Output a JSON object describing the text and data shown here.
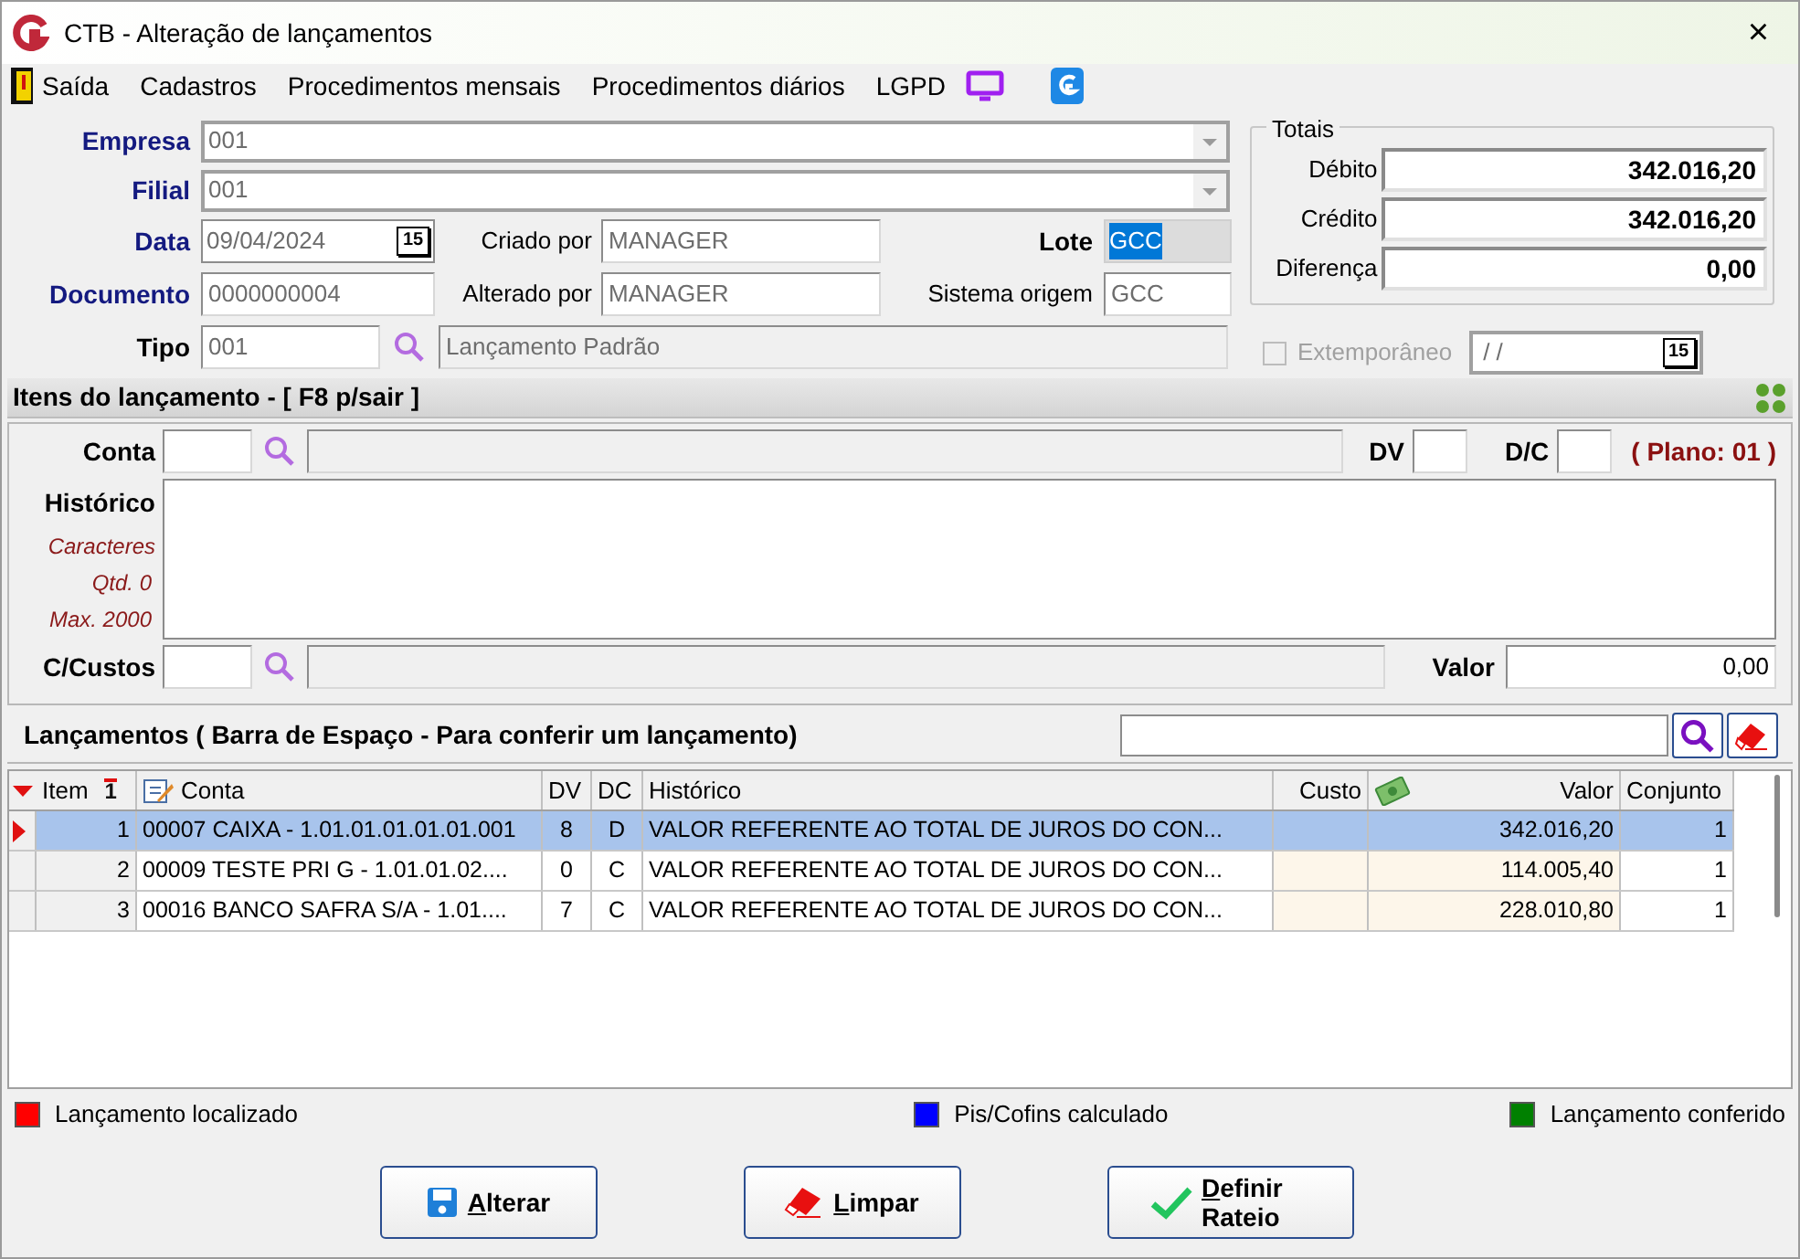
{
  "window": {
    "title": "CTB - Alteração de lançamentos",
    "close": "×"
  },
  "menu": [
    {
      "label": "Saída",
      "kind": "exit"
    },
    {
      "label": "Cadastros"
    },
    {
      "label": "Procedimentos mensais"
    },
    {
      "label": "Procedimentos diários"
    },
    {
      "label": "LGPD"
    }
  ],
  "header": {
    "empresa": {
      "label": "Empresa",
      "value": "001"
    },
    "filial": {
      "label": "Filial",
      "value": "001"
    },
    "data": {
      "label": "Data",
      "value": "09/04/2024",
      "calendar": "15"
    },
    "documento": {
      "label": "Documento",
      "value": "0000000004"
    },
    "tipo": {
      "label": "Tipo",
      "value": "001",
      "description": "Lançamento Padrão"
    },
    "criado_por": {
      "label": "Criado por",
      "value": "MANAGER"
    },
    "alterado_por": {
      "label": "Alterado por",
      "value": "MANAGER"
    },
    "lote": {
      "label": "Lote",
      "value": "GCC",
      "selected": true
    },
    "sistema_origem": {
      "label": "Sistema origem",
      "value": "GCC"
    }
  },
  "totais": {
    "title": "Totais",
    "rows": [
      {
        "label": "Débito",
        "value": "342.016,20"
      },
      {
        "label": "Crédito",
        "value": "342.016,20"
      },
      {
        "label": "Diferença",
        "value": "0,00"
      }
    ]
  },
  "extemporaneo": {
    "label": "Extemporâneo",
    "checked": false,
    "disabled": true,
    "value": "/ /",
    "calendar": "15"
  },
  "itens": {
    "title": "Itens do lançamento - [ F8 p/sair ]",
    "conta_label": "Conta",
    "dv_label": "DV",
    "dc_label": "D/C",
    "plano": "( Plano: 01 )",
    "historico_label": "Histórico",
    "caracteres": [
      "Caracteres",
      "Qtd. 0",
      "Max. 2000"
    ],
    "ccustos_label": "C/Custos",
    "valor_label": "Valor",
    "valor": "0,00"
  },
  "lancamentos": {
    "title": "Lançamentos ( Barra de Espaço - Para conferir um lançamento)"
  },
  "table": {
    "columns": [
      "Item",
      "Conta",
      "DV",
      "DC",
      "Histórico",
      "Custo",
      "Valor",
      "Conjunto"
    ],
    "sort_label": "1",
    "rows": [
      {
        "item": "1",
        "conta": "00007 CAIXA - 1.01.01.01.01.01.001",
        "dv": "8",
        "dc": "D",
        "historico": "VALOR REFERENTE AO TOTAL DE JUROS DO CON...",
        "valor": "342.016,20",
        "conjunto": "1",
        "selected": true
      },
      {
        "item": "2",
        "conta": "00009 TESTE PRI G - 1.01.01.02....",
        "dv": "0",
        "dc": "C",
        "historico": "VALOR REFERENTE AO TOTAL DE JUROS DO CON...",
        "valor": "114.005,40",
        "conjunto": "1",
        "selected": false
      },
      {
        "item": "3",
        "conta": "00016 BANCO SAFRA S/A - 1.01....",
        "dv": "7",
        "dc": "C",
        "historico": "VALOR REFERENTE AO TOTAL DE JUROS DO CON...",
        "valor": "228.010,80",
        "conjunto": "1",
        "selected": false
      }
    ]
  },
  "legend": [
    {
      "label": "Lançamento localizado",
      "color": "#ff0000"
    },
    {
      "label": "Pis/Cofins calculado",
      "color": "#0000ff"
    },
    {
      "label": "Lançamento conferido",
      "color": "#008000"
    }
  ],
  "buttons": [
    {
      "label": "Alterar",
      "kind": "save"
    },
    {
      "label": "Limpar",
      "kind": "eraser"
    },
    {
      "label": "Definir Rateio",
      "kind": "check"
    }
  ]
}
